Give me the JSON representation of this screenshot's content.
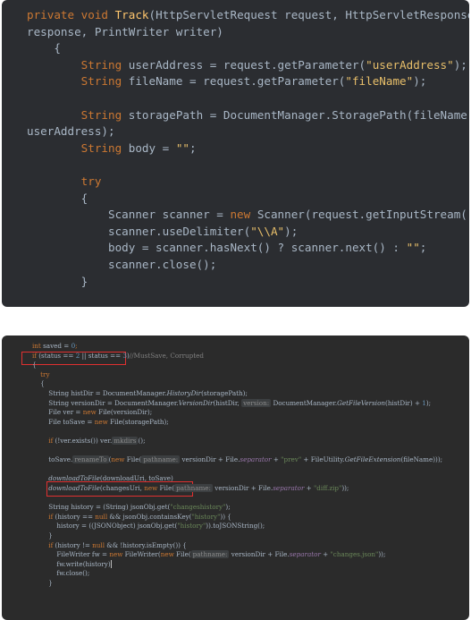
{
  "top_code": {
    "lines": [
      [
        {
          "t": "private void ",
          "c": "kw"
        },
        {
          "t": "Track",
          "c": "fn"
        },
        {
          "t": "(HttpServletRequest request, HttpServletResponse",
          "c": ""
        }
      ],
      [
        {
          "t": "response, PrintWriter writer)",
          "c": ""
        }
      ],
      [
        {
          "t": "    {",
          "c": ""
        }
      ],
      [
        {
          "t": "        ",
          "c": ""
        },
        {
          "t": "String ",
          "c": "kw"
        },
        {
          "t": "userAddress = request.getParameter(",
          "c": ""
        },
        {
          "t": "\"userAddress\"",
          "c": "str"
        },
        {
          "t": ");",
          "c": ""
        }
      ],
      [
        {
          "t": "        ",
          "c": ""
        },
        {
          "t": "String ",
          "c": "kw"
        },
        {
          "t": "fileName = request.getParameter(",
          "c": ""
        },
        {
          "t": "\"fileName\"",
          "c": "str"
        },
        {
          "t": ");",
          "c": ""
        }
      ],
      [
        {
          "t": "",
          "c": ""
        }
      ],
      [
        {
          "t": "        ",
          "c": ""
        },
        {
          "t": "String ",
          "c": "kw"
        },
        {
          "t": "storagePath = DocumentManager.StoragePath(fileName,",
          "c": ""
        }
      ],
      [
        {
          "t": "userAddress);",
          "c": ""
        }
      ],
      [
        {
          "t": "        ",
          "c": ""
        },
        {
          "t": "String ",
          "c": "kw"
        },
        {
          "t": "body = ",
          "c": ""
        },
        {
          "t": "\"\"",
          "c": "str"
        },
        {
          "t": ";",
          "c": ""
        }
      ],
      [
        {
          "t": "",
          "c": ""
        }
      ],
      [
        {
          "t": "        ",
          "c": ""
        },
        {
          "t": "try",
          "c": "kw"
        }
      ],
      [
        {
          "t": "        {",
          "c": ""
        }
      ],
      [
        {
          "t": "            Scanner scanner = ",
          "c": ""
        },
        {
          "t": "new ",
          "c": "kw"
        },
        {
          "t": "Scanner(request.getInputStream());",
          "c": ""
        }
      ],
      [
        {
          "t": "            scanner.useDelimiter(",
          "c": ""
        },
        {
          "t": "\"\\\\A\"",
          "c": "str"
        },
        {
          "t": ");",
          "c": ""
        }
      ],
      [
        {
          "t": "            body = scanner.hasNext() ? scanner.next() : ",
          "c": ""
        },
        {
          "t": "\"\"",
          "c": "str"
        },
        {
          "t": ";",
          "c": ""
        }
      ],
      [
        {
          "t": "            scanner.close();",
          "c": ""
        }
      ],
      [
        {
          "t": "        }",
          "c": ""
        }
      ]
    ]
  },
  "bottom_code": {
    "lines": [
      [
        {
          "t": "int ",
          "c": "kw"
        },
        {
          "t": "saved = ",
          "c": ""
        },
        {
          "t": "0",
          "c": "num"
        },
        {
          "t": ";",
          "c": "kw"
        }
      ],
      [
        {
          "t": "if ",
          "c": "kw"
        },
        {
          "t": "(status == ",
          "c": ""
        },
        {
          "t": "2 ",
          "c": "num"
        },
        {
          "t": "|| status == ",
          "c": ""
        },
        {
          "t": "3",
          "c": "num"
        },
        {
          "t": ")",
          "c": ""
        },
        {
          "t": "//MustSave, Corrupted",
          "c": "cmt"
        }
      ],
      [
        {
          "t": "{",
          "c": ""
        }
      ],
      [
        {
          "t": "    try",
          "c": "kw"
        }
      ],
      [
        {
          "t": "    {",
          "c": ""
        }
      ],
      [
        {
          "t": "        String histDir = DocumentManager.",
          "c": ""
        },
        {
          "t": "HistoryDir",
          "c": "it"
        },
        {
          "t": "(storagePath);",
          "c": ""
        }
      ],
      [
        {
          "t": "        String versionDir = DocumentManager.",
          "c": ""
        },
        {
          "t": "VersionDir",
          "c": "it"
        },
        {
          "t": "(histDir, ",
          "c": ""
        },
        {
          "t": "version:",
          "c": "hint"
        },
        {
          "t": " DocumentManager.",
          "c": ""
        },
        {
          "t": "GetFileVersion",
          "c": "it"
        },
        {
          "t": "(histDir) + ",
          "c": ""
        },
        {
          "t": "1",
          "c": "num"
        },
        {
          "t": ");",
          "c": ""
        }
      ],
      [
        {
          "t": "        File ver = ",
          "c": ""
        },
        {
          "t": "new ",
          "c": "kw"
        },
        {
          "t": "File(versionDir);",
          "c": ""
        }
      ],
      [
        {
          "t": "        File toSave = ",
          "c": ""
        },
        {
          "t": "new ",
          "c": "kw"
        },
        {
          "t": "File(storagePath);",
          "c": ""
        }
      ],
      [
        {
          "t": "",
          "c": ""
        }
      ],
      [
        {
          "t": "        ",
          "c": ""
        },
        {
          "t": "if ",
          "c": "kw"
        },
        {
          "t": "(!ver.exists()) ver.",
          "c": ""
        },
        {
          "t": "mkdirs",
          "c": "hint"
        },
        {
          "t": "();",
          "c": ""
        }
      ],
      [
        {
          "t": "",
          "c": ""
        }
      ],
      [
        {
          "t": "        toSave.",
          "c": ""
        },
        {
          "t": "renameTo",
          "c": "hint"
        },
        {
          "t": "(",
          "c": ""
        },
        {
          "t": "new ",
          "c": "kw"
        },
        {
          "t": "File(",
          "c": ""
        },
        {
          "t": "pathname:",
          "c": "hint"
        },
        {
          "t": " versionDir + File.",
          "c": ""
        },
        {
          "t": "separator",
          "c": "purple"
        },
        {
          "t": " + ",
          "c": ""
        },
        {
          "t": "\"prev\"",
          "c": "str2"
        },
        {
          "t": " + FileUtility.",
          "c": ""
        },
        {
          "t": "GetFileExtension",
          "c": "it"
        },
        {
          "t": "(fileName)));",
          "c": ""
        }
      ],
      [
        {
          "t": "",
          "c": ""
        }
      ],
      [
        {
          "t": "        ",
          "c": ""
        },
        {
          "t": "downloadToFile",
          "c": "it"
        },
        {
          "t": "(downloadUri, toSave)",
          "c": ""
        }
      ],
      [
        {
          "t": "        ",
          "c": ""
        },
        {
          "t": "downloadToFile",
          "c": "it"
        },
        {
          "t": "(changesUri, ",
          "c": ""
        },
        {
          "t": "new ",
          "c": "kw"
        },
        {
          "t": "File(",
          "c": ""
        },
        {
          "t": "pathname:",
          "c": "hint"
        },
        {
          "t": " versionDir + File.",
          "c": ""
        },
        {
          "t": "separator",
          "c": "purple"
        },
        {
          "t": " + ",
          "c": ""
        },
        {
          "t": "\"diff.zip\"",
          "c": "str2"
        },
        {
          "t": "));",
          "c": ""
        }
      ],
      [
        {
          "t": "",
          "c": ""
        }
      ],
      [
        {
          "t": "        String history = (String) jsonObj.get(",
          "c": ""
        },
        {
          "t": "\"changeshistory\"",
          "c": "str2"
        },
        {
          "t": ");",
          "c": ""
        }
      ],
      [
        {
          "t": "        ",
          "c": ""
        },
        {
          "t": "if ",
          "c": "kw"
        },
        {
          "t": "(history == ",
          "c": ""
        },
        {
          "t": "null ",
          "c": "kw"
        },
        {
          "t": "&& jsonObj.containsKey(",
          "c": ""
        },
        {
          "t": "\"history\"",
          "c": "str2"
        },
        {
          "t": ")) {",
          "c": ""
        }
      ],
      [
        {
          "t": "            history = ((JSONObject) jsonObj.get(",
          "c": ""
        },
        {
          "t": "\"history\"",
          "c": "str2"
        },
        {
          "t": ")).toJSONString();",
          "c": ""
        }
      ],
      [
        {
          "t": "        }",
          "c": ""
        }
      ],
      [
        {
          "t": "        ",
          "c": ""
        },
        {
          "t": "if ",
          "c": "kw"
        },
        {
          "t": "(history != ",
          "c": ""
        },
        {
          "t": "null ",
          "c": "kw"
        },
        {
          "t": "&& !history.isEmpty()) {",
          "c": ""
        }
      ],
      [
        {
          "t": "            FileWriter fw = ",
          "c": ""
        },
        {
          "t": "new ",
          "c": "kw"
        },
        {
          "t": "FileWriter(",
          "c": ""
        },
        {
          "t": "new ",
          "c": "kw"
        },
        {
          "t": "File(",
          "c": ""
        },
        {
          "t": "pathname:",
          "c": "hint"
        },
        {
          "t": " versionDir + File.",
          "c": ""
        },
        {
          "t": "separator",
          "c": "purple"
        },
        {
          "t": " + ",
          "c": ""
        },
        {
          "t": "\"changes.json\"",
          "c": "str2"
        },
        {
          "t": "));",
          "c": ""
        }
      ],
      [
        {
          "t": "            fw.write(history)",
          "c": ""
        }
      ],
      [
        {
          "t": "            fw.close();",
          "c": ""
        }
      ],
      [
        {
          "t": "        }",
          "c": ""
        }
      ]
    ]
  },
  "colors": {
    "keyword": "#cc7832",
    "string_top": "#e8bf6a",
    "string_bottom": "#6a8759",
    "number": "#6897bb",
    "method": "#ffc66d",
    "comment": "#808080",
    "highlight_box": "#e03030"
  }
}
